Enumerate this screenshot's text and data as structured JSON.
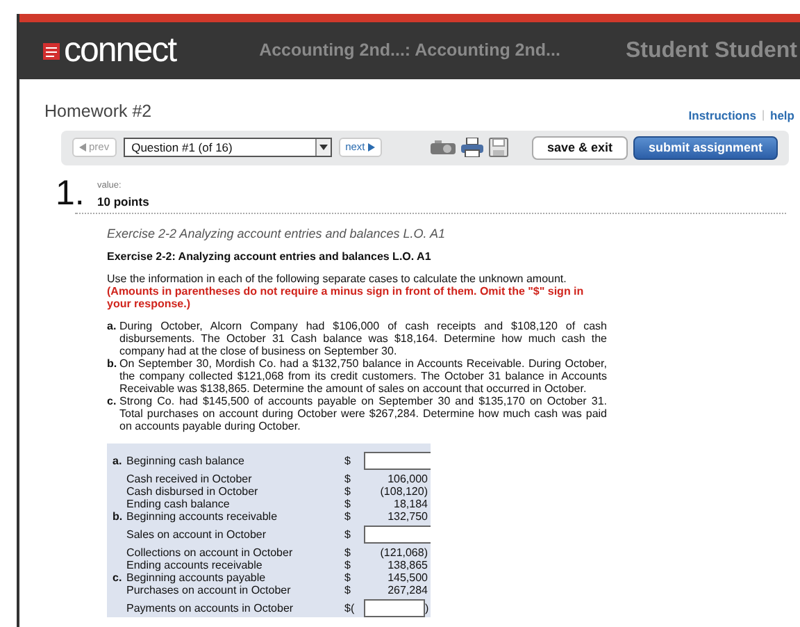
{
  "header": {
    "logo": "connect",
    "course": "Accounting 2nd...: Accounting 2nd...",
    "user": "Student Student"
  },
  "assignment": {
    "title": "Homework #2",
    "links": [
      "Instructions",
      "help"
    ],
    "link_separator": "|"
  },
  "toolbar": {
    "prev": {
      "label": "prev",
      "disabled": true
    },
    "question_select": "Question #1 (of 16)",
    "next": {
      "label": "next",
      "disabled": false
    },
    "buttons": [
      {
        "label": "save & exit",
        "kind": "plain"
      },
      {
        "label": "submit assignment",
        "kind": "primary"
      }
    ]
  },
  "question": {
    "number": "1.",
    "value_label": "value:",
    "points": "10 points",
    "subtitle": "Exercise 2-2 Analyzing account entries and balances L.O. A1",
    "heading": "Exercise 2-2: Analyzing account entries and balances L.O. A1",
    "instructions": "Use the information in each of the following separate cases to calculate the unknown amount.",
    "warning": "(Amounts in parentheses do not require a minus sign in front of them. Omit the \"$\" sign in your response.)",
    "cases": [
      {
        "letter": "a.",
        "text": "During October, Alcorn Company had $106,000 of cash receipts and $108,120 of cash disbursements. The October 31 Cash balance was $18,164. Determine how much cash the company had at the close of business on September 30."
      },
      {
        "letter": "b.",
        "text": "On September 30, Mordish Co. had a $132,750 balance in Accounts Receivable. During October, the company collected $121,068 from its credit customers. The October 31 balance in Accounts Receivable was $138,865. Determine the amount of sales on account that occurred in October."
      },
      {
        "letter": "c.",
        "text": "Strong Co. had $145,500 of accounts payable on September 30 and $135,170 on October 31. Total purchases on account during October were $267,284. Determine how much cash was paid on accounts payable during October."
      }
    ]
  },
  "answer_table": [
    {
      "letter": "a.",
      "label": "Beginning cash balance",
      "currency": "$",
      "kind": "input"
    },
    {
      "label": "Cash received in October",
      "currency": "$",
      "kind": "value",
      "value": "106,000"
    },
    {
      "label": "Cash disbursed in October",
      "currency": "$",
      "kind": "value",
      "value": "(108,120)"
    },
    {
      "label": "Ending cash balance",
      "currency": "$",
      "kind": "value",
      "value": "18,184"
    },
    {
      "letter": "b.",
      "label": "Beginning accounts receivable",
      "currency": "$",
      "kind": "value",
      "value": "132,750"
    },
    {
      "label": "Sales on account in October",
      "currency": "$",
      "kind": "input"
    },
    {
      "label": "Collections on account in October",
      "currency": "$",
      "kind": "value",
      "value": "(121,068)"
    },
    {
      "label": "Ending accounts receivable",
      "currency": "$",
      "kind": "value",
      "value": "138,865"
    },
    {
      "letter": "c.",
      "label": "Beginning accounts payable",
      "currency": "$",
      "kind": "value",
      "value": "145,500"
    },
    {
      "label": "Purchases on account in October",
      "currency": "$",
      "kind": "value",
      "value": "267,284"
    },
    {
      "label": "Payments on accounts in October",
      "currency": "$(",
      "kind": "input",
      "suffix": ")"
    }
  ]
}
